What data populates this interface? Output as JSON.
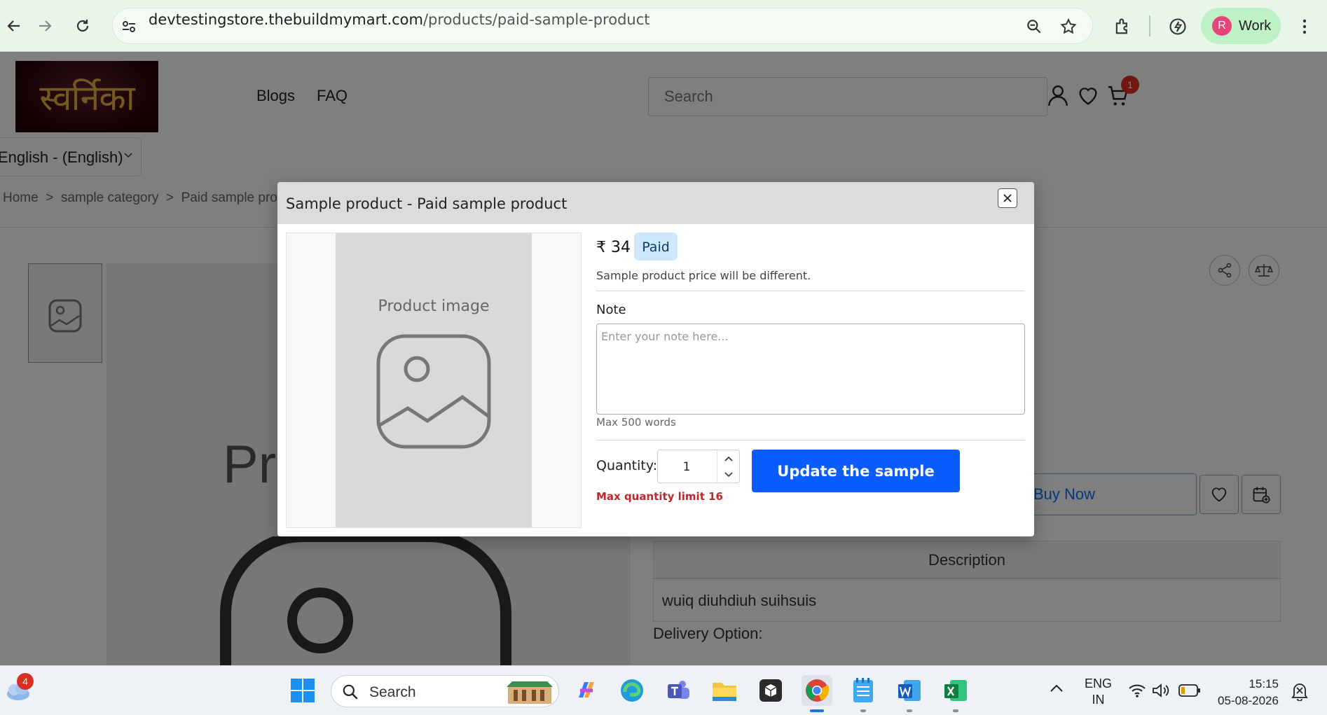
{
  "browser": {
    "url_host": "devtestingstore.thebuildmymart.com",
    "url_path": "/products/paid-sample-product",
    "profile_initial": "R",
    "profile_name": "Work"
  },
  "site": {
    "logo_text": "स्वर्निका",
    "nav": [
      "Blogs",
      "FAQ"
    ],
    "search_placeholder": "Search",
    "cart_count": "1",
    "language": "English - (English)",
    "breadcrumb": [
      "Home",
      ">",
      "sample category",
      ">",
      "Paid sample pro"
    ],
    "main_image_text": "Pro",
    "buy_now": "Buy Now",
    "description_tab": "Description",
    "description_text": "wuiq diuhdiuh suihsuis",
    "delivery_label": "Delivery Option:"
  },
  "modal": {
    "title": "Sample product - Paid sample product",
    "image_label": "Product image",
    "price": "₹ 34",
    "badge": "Paid",
    "price_note": "Sample product price will be different.",
    "note_label": "Note",
    "note_placeholder": "Enter your note here...",
    "max_words": "Max 500 words",
    "quantity_label": "Quantity:",
    "quantity_value": "1",
    "quantity_limit": "Max quantity limit 16",
    "update_button": "Update the sample"
  },
  "taskbar": {
    "weather_badge": "4",
    "search_label": "Search",
    "lang_line1": "ENG",
    "lang_line2": "IN",
    "time": "15:15",
    "date": "05-08-2026"
  },
  "colors": {
    "primary_button": "#0a5cff",
    "badge_bg": "#cfe7fb",
    "limit_text": "#c0262d",
    "profile_chip": "#bff1c6"
  }
}
